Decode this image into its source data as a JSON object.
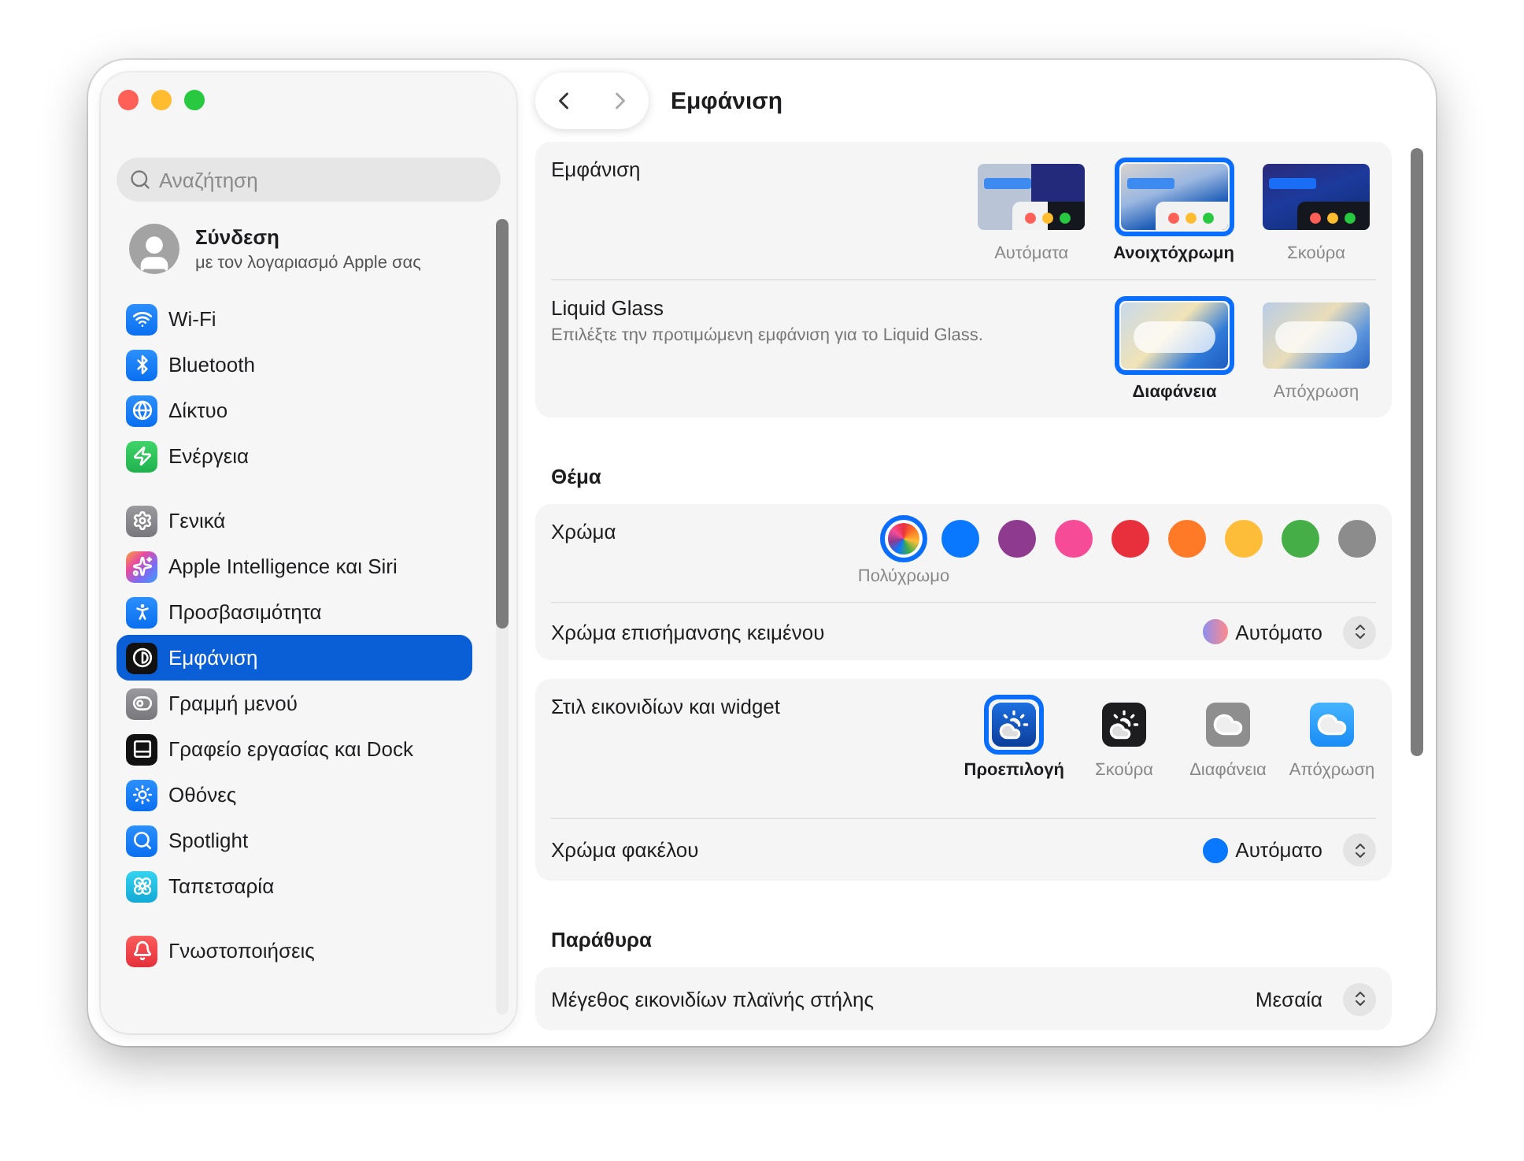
{
  "window": {
    "title": "Εμφάνιση"
  },
  "sidebar": {
    "search": {
      "placeholder": "Αναζήτηση"
    },
    "account": {
      "name": "Σύνδεση",
      "subtitle": "με τον λογαριασμό Apple σας"
    },
    "groups": [
      [
        {
          "label": "Wi-Fi",
          "selected": false
        },
        {
          "label": "Bluetooth",
          "selected": false
        },
        {
          "label": "Δίκτυο",
          "selected": false
        },
        {
          "label": "Ενέργεια",
          "selected": false
        }
      ],
      [
        {
          "label": "Γενικά",
          "selected": false
        },
        {
          "label": "Apple Intelligence και Siri",
          "selected": false
        },
        {
          "label": "Προσβασιμότητα",
          "selected": false
        },
        {
          "label": "Εμφάνιση",
          "selected": true
        },
        {
          "label": "Γραμμή μενού",
          "selected": false
        },
        {
          "label": "Γραφείο εργασίας και Dock",
          "selected": false
        },
        {
          "label": "Οθόνες",
          "selected": false
        },
        {
          "label": "Spotlight",
          "selected": false
        },
        {
          "label": "Ταπετσαρία",
          "selected": false
        }
      ],
      [
        {
          "label": "Γνωστοποιήσεις",
          "selected": false
        }
      ]
    ]
  },
  "appearance": {
    "label": "Εμφάνιση",
    "options": [
      {
        "label": "Αυτόματα",
        "kind": "auto",
        "selected": false
      },
      {
        "label": "Ανοιχτόχρωμη",
        "kind": "light",
        "selected": true
      },
      {
        "label": "Σκούρα",
        "kind": "dark",
        "selected": false
      }
    ]
  },
  "liquid_glass": {
    "label": "Liquid Glass",
    "description": "Επιλέξτε την προτιμώμενη εμφάνιση για το Liquid Glass.",
    "options": [
      {
        "label": "Διαφάνεια",
        "kind": "clear",
        "selected": true
      },
      {
        "label": "Απόχρωση",
        "kind": "tinted",
        "selected": false
      }
    ]
  },
  "theme": {
    "heading": "Θέμα",
    "color": {
      "label": "Χρώμα",
      "swatches": [
        {
          "kind": "multicolor",
          "label": "Πολύχρωμο",
          "selected": true
        },
        {
          "kind": "solid",
          "color": "#0a78fe",
          "selected": false
        },
        {
          "kind": "solid",
          "color": "#8d3a8f",
          "selected": false
        },
        {
          "kind": "solid",
          "color": "#f64c97",
          "selected": false
        },
        {
          "kind": "solid",
          "color": "#e8303d",
          "selected": false
        },
        {
          "kind": "solid",
          "color": "#fe7a26",
          "selected": false
        },
        {
          "kind": "solid",
          "color": "#febd38",
          "selected": false
        },
        {
          "kind": "solid",
          "color": "#45ae47",
          "selected": false
        },
        {
          "kind": "solid",
          "color": "#8c8c8c",
          "selected": false
        }
      ]
    },
    "highlight": {
      "label": "Χρώμα επισήμανσης κειμένου",
      "value": "Αυτόματο"
    },
    "icon_style": {
      "label": "Στιλ εικονιδίων και widget",
      "options": [
        {
          "label": "Προεπιλογή",
          "kind": "default",
          "selected": true
        },
        {
          "label": "Σκούρα",
          "kind": "dark",
          "selected": false
        },
        {
          "label": "Διαφάνεια",
          "kind": "clear",
          "selected": false
        },
        {
          "label": "Απόχρωση",
          "kind": "tinted",
          "selected": false
        }
      ]
    },
    "folder_color": {
      "label": "Χρώμα φακέλου",
      "value": "Αυτόματο"
    }
  },
  "windows": {
    "heading": "Παράθυρα",
    "sidebar_icon_size": {
      "label": "Μέγεθος εικονιδίων πλαϊνής στήλης",
      "value": "Μεσαία"
    }
  }
}
